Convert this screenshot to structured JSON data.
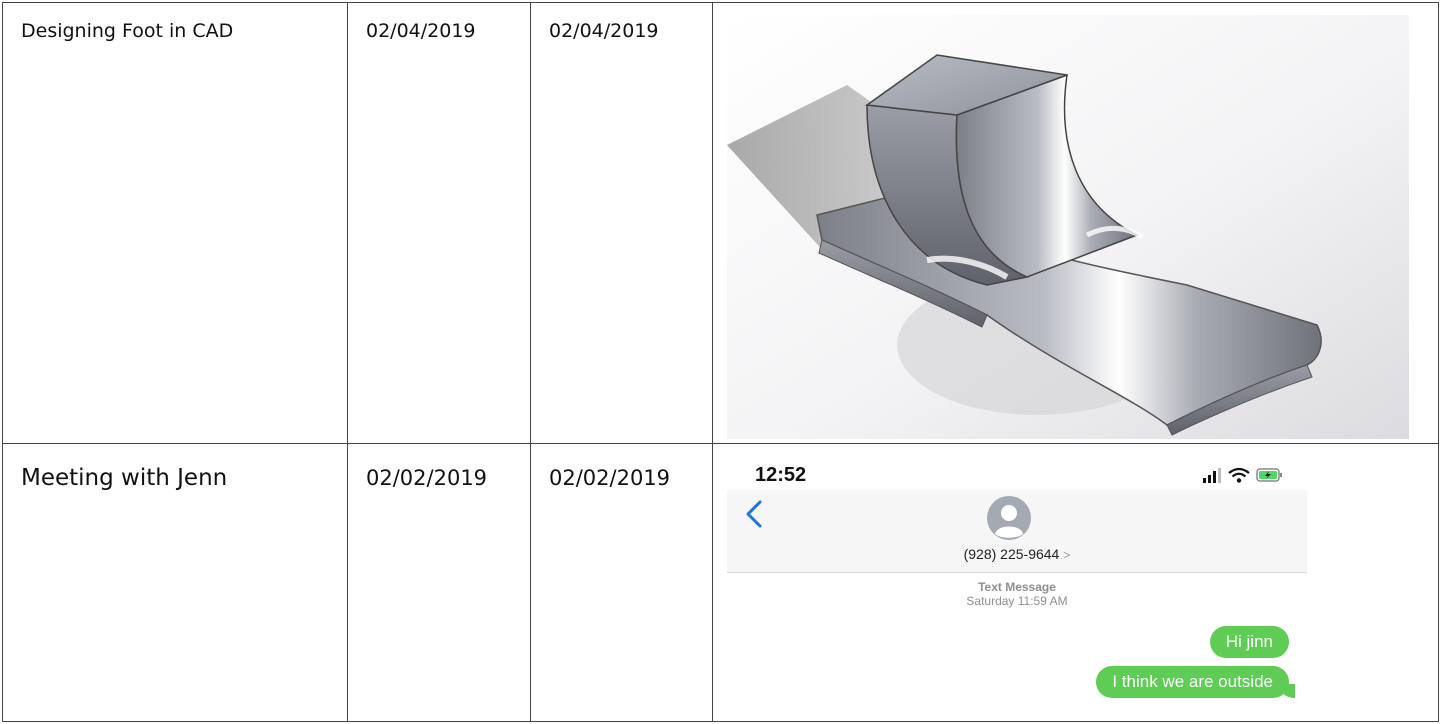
{
  "rows": [
    {
      "task": "Designing Foot in CAD",
      "start_date": "02/04/2019",
      "end_date": "02/04/2019",
      "evidence": "cad-render"
    },
    {
      "task": "Meeting with Jenn",
      "start_date": "02/02/2019",
      "end_date": "02/02/2019",
      "evidence": "text-message-screenshot"
    }
  ],
  "phone": {
    "time": "12:52",
    "contact_number": "(928) 225-9644",
    "contact_chevron": ">",
    "meta_title": "Text Message",
    "meta_time": "Saturday 11:59 AM",
    "messages": [
      "Hi jinn",
      "I think we are outside"
    ],
    "bubble_color": "#5fcd55",
    "back_color": "#1a73e8"
  },
  "icons": {
    "status": [
      "signal-icon",
      "wifi-icon",
      "battery-charging-icon"
    ],
    "back": "chevron-left-icon",
    "avatar": "contact-avatar-icon"
  }
}
